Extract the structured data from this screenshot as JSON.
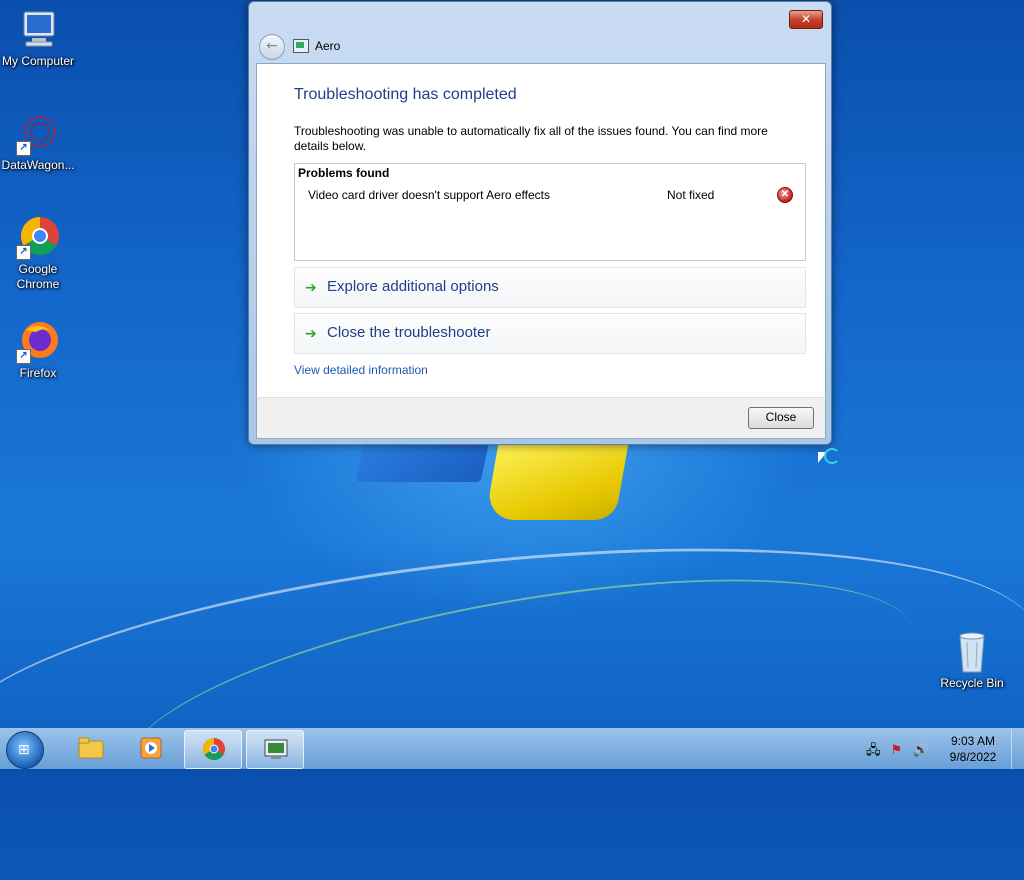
{
  "desktop": {
    "icons": [
      {
        "label": "My Computer"
      },
      {
        "label": "DataWagon..."
      },
      {
        "label": "Google Chrome"
      },
      {
        "label": "Firefox"
      },
      {
        "label": "Recycle Bin"
      }
    ]
  },
  "dialog": {
    "close_glyph": "✕",
    "back_glyph": "←",
    "nav_title": "Aero",
    "heading": "Troubleshooting has completed",
    "description": "Troubleshooting was unable to automatically fix all of the issues found. You can find more details below.",
    "problems": {
      "title": "Problems found",
      "rows": [
        {
          "name": "Video card driver doesn't support Aero effects",
          "status": "Not fixed",
          "status_icon": "error-icon"
        }
      ]
    },
    "options": [
      {
        "label": "Explore additional options",
        "icon": "arrow-right-icon"
      },
      {
        "label": "Close the troubleshooter",
        "icon": "arrow-right-icon"
      }
    ],
    "detail_link": "View detailed information",
    "close_button": "Close"
  },
  "taskbar": {
    "start_glyph": "⊞",
    "clock_time": "9:03 AM",
    "clock_date": "9/8/2022"
  },
  "colors": {
    "heading": "#1e3f8a",
    "link": "#1e5bb0",
    "arrow": "#2aa52a",
    "error": "#c42020"
  }
}
